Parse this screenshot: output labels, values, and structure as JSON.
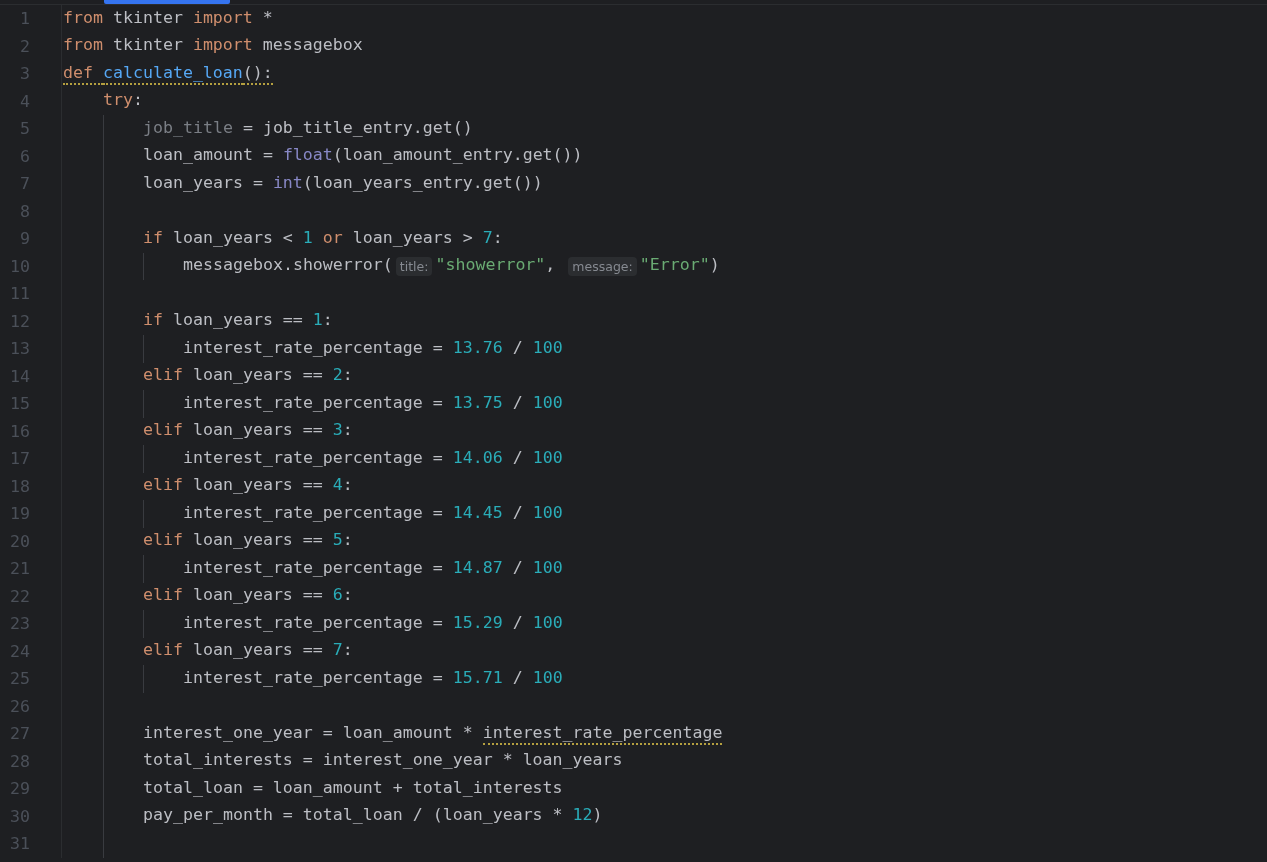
{
  "editor": {
    "lines": [
      {
        "number": "1",
        "tokens": [
          {
            "kind": "keyword",
            "text": "from",
            "warning": false
          },
          {
            "kind": "text",
            "text": " tkinter ",
            "warning": false
          },
          {
            "kind": "keyword",
            "text": "import",
            "warning": false
          },
          {
            "kind": "text",
            "text": " *",
            "warning": false
          }
        ]
      },
      {
        "number": "2",
        "tokens": [
          {
            "kind": "keyword",
            "text": "from",
            "warning": false
          },
          {
            "kind": "text",
            "text": " tkinter ",
            "warning": false
          },
          {
            "kind": "keyword",
            "text": "import",
            "warning": false
          },
          {
            "kind": "text",
            "text": " messagebox",
            "warning": false
          }
        ]
      },
      {
        "number": "3",
        "tokens": [
          {
            "kind": "keyword",
            "text": "def ",
            "warning": true
          },
          {
            "kind": "function",
            "text": "calculate_loan",
            "warning": true
          },
          {
            "kind": "text",
            "text": "():",
            "warning": true
          }
        ],
        "children": [
          {
            "number": "4",
            "tokens": [
              {
                "kind": "keyword",
                "text": "try",
                "warning": false
              },
              {
                "kind": "text",
                "text": ":",
                "warning": false
              }
            ],
            "children": [
              {
                "number": "5",
                "tokens": [
                  {
                    "kind": "unused",
                    "text": "job_title",
                    "warning": false
                  },
                  {
                    "kind": "text",
                    "text": " = job_title_entry.get()",
                    "warning": false
                  }
                ]
              },
              {
                "number": "6",
                "tokens": [
                  {
                    "kind": "text",
                    "text": "loan_amount = ",
                    "warning": false
                  },
                  {
                    "kind": "builtin",
                    "text": "float",
                    "warning": false
                  },
                  {
                    "kind": "text",
                    "text": "(loan_amount_entry.get())",
                    "warning": false
                  }
                ]
              },
              {
                "number": "7",
                "tokens": [
                  {
                    "kind": "text",
                    "text": "loan_years = ",
                    "warning": false
                  },
                  {
                    "kind": "builtin",
                    "text": "int",
                    "warning": false
                  },
                  {
                    "kind": "text",
                    "text": "(loan_years_entry.get())",
                    "warning": false
                  }
                ]
              },
              {
                "number": "8"
              },
              {
                "number": "9",
                "tokens": [
                  {
                    "kind": "keyword",
                    "text": "if",
                    "warning": false
                  },
                  {
                    "kind": "text",
                    "text": " loan_years < ",
                    "warning": false
                  },
                  {
                    "kind": "number",
                    "text": "1",
                    "warning": false
                  },
                  {
                    "kind": "keyword",
                    "text": " or",
                    "warning": false
                  },
                  {
                    "kind": "text",
                    "text": " loan_years > ",
                    "warning": false
                  },
                  {
                    "kind": "number",
                    "text": "7",
                    "warning": false
                  },
                  {
                    "kind": "text",
                    "text": ":",
                    "warning": false
                  }
                ],
                "children": [
                  {
                    "number": "10",
                    "tokens": [
                      {
                        "kind": "text",
                        "text": "messagebox.showerror(",
                        "warning": false
                      },
                      {
                        "kind": "hint",
                        "text": "title:",
                        "warning": false
                      },
                      {
                        "kind": "string",
                        "text": "\"showerror\"",
                        "warning": false
                      },
                      {
                        "kind": "text",
                        "text": ", ",
                        "warning": false
                      },
                      {
                        "kind": "hint",
                        "text": "message:",
                        "warning": false
                      },
                      {
                        "kind": "string",
                        "text": "\"Error\"",
                        "warning": false
                      },
                      {
                        "kind": "text",
                        "text": ")",
                        "warning": false
                      }
                    ]
                  }
                ]
              },
              {
                "number": "11"
              },
              {
                "number": "12",
                "tokens": [
                  {
                    "kind": "keyword",
                    "text": "if",
                    "warning": false
                  },
                  {
                    "kind": "text",
                    "text": " loan_years == ",
                    "warning": false
                  },
                  {
                    "kind": "number",
                    "text": "1",
                    "warning": false
                  },
                  {
                    "kind": "text",
                    "text": ":",
                    "warning": false
                  }
                ],
                "children": [
                  {
                    "number": "13",
                    "tokens": [
                      {
                        "kind": "text",
                        "text": "interest_rate_percentage = ",
                        "warning": false
                      },
                      {
                        "kind": "number",
                        "text": "13.76",
                        "warning": false
                      },
                      {
                        "kind": "text",
                        "text": " / ",
                        "warning": false
                      },
                      {
                        "kind": "number",
                        "text": "100",
                        "warning": false
                      }
                    ]
                  }
                ]
              },
              {
                "number": "14",
                "tokens": [
                  {
                    "kind": "keyword",
                    "text": "elif",
                    "warning": false
                  },
                  {
                    "kind": "text",
                    "text": " loan_years == ",
                    "warning": false
                  },
                  {
                    "kind": "number",
                    "text": "2",
                    "warning": false
                  },
                  {
                    "kind": "text",
                    "text": ":",
                    "warning": false
                  }
                ],
                "children": [
                  {
                    "number": "15",
                    "tokens": [
                      {
                        "kind": "text",
                        "text": "interest_rate_percentage = ",
                        "warning": false
                      },
                      {
                        "kind": "number",
                        "text": "13.75",
                        "warning": false
                      },
                      {
                        "kind": "text",
                        "text": " / ",
                        "warning": false
                      },
                      {
                        "kind": "number",
                        "text": "100",
                        "warning": false
                      }
                    ]
                  }
                ]
              },
              {
                "number": "16",
                "tokens": [
                  {
                    "kind": "keyword",
                    "text": "elif",
                    "warning": false
                  },
                  {
                    "kind": "text",
                    "text": " loan_years == ",
                    "warning": false
                  },
                  {
                    "kind": "number",
                    "text": "3",
                    "warning": false
                  },
                  {
                    "kind": "text",
                    "text": ":",
                    "warning": false
                  }
                ],
                "children": [
                  {
                    "number": "17",
                    "tokens": [
                      {
                        "kind": "text",
                        "text": "interest_rate_percentage = ",
                        "warning": false
                      },
                      {
                        "kind": "number",
                        "text": "14.06",
                        "warning": false
                      },
                      {
                        "kind": "text",
                        "text": " / ",
                        "warning": false
                      },
                      {
                        "kind": "number",
                        "text": "100",
                        "warning": false
                      }
                    ]
                  }
                ]
              },
              {
                "number": "18",
                "tokens": [
                  {
                    "kind": "keyword",
                    "text": "elif",
                    "warning": false
                  },
                  {
                    "kind": "text",
                    "text": " loan_years == ",
                    "warning": false
                  },
                  {
                    "kind": "number",
                    "text": "4",
                    "warning": false
                  },
                  {
                    "kind": "text",
                    "text": ":",
                    "warning": false
                  }
                ],
                "children": [
                  {
                    "number": "19",
                    "tokens": [
                      {
                        "kind": "text",
                        "text": "interest_rate_percentage = ",
                        "warning": false
                      },
                      {
                        "kind": "number",
                        "text": "14.45",
                        "warning": false
                      },
                      {
                        "kind": "text",
                        "text": " / ",
                        "warning": false
                      },
                      {
                        "kind": "number",
                        "text": "100",
                        "warning": false
                      }
                    ]
                  }
                ]
              },
              {
                "number": "20",
                "tokens": [
                  {
                    "kind": "keyword",
                    "text": "elif",
                    "warning": false
                  },
                  {
                    "kind": "text",
                    "text": " loan_years == ",
                    "warning": false
                  },
                  {
                    "kind": "number",
                    "text": "5",
                    "warning": false
                  },
                  {
                    "kind": "text",
                    "text": ":",
                    "warning": false
                  }
                ],
                "children": [
                  {
                    "number": "21",
                    "tokens": [
                      {
                        "kind": "text",
                        "text": "interest_rate_percentage = ",
                        "warning": false
                      },
                      {
                        "kind": "number",
                        "text": "14.87",
                        "warning": false
                      },
                      {
                        "kind": "text",
                        "text": " / ",
                        "warning": false
                      },
                      {
                        "kind": "number",
                        "text": "100",
                        "warning": false
                      }
                    ]
                  }
                ]
              },
              {
                "number": "22",
                "tokens": [
                  {
                    "kind": "keyword",
                    "text": "elif",
                    "warning": false
                  },
                  {
                    "kind": "text",
                    "text": " loan_years == ",
                    "warning": false
                  },
                  {
                    "kind": "number",
                    "text": "6",
                    "warning": false
                  },
                  {
                    "kind": "text",
                    "text": ":",
                    "warning": false
                  }
                ],
                "children": [
                  {
                    "number": "23",
                    "tokens": [
                      {
                        "kind": "text",
                        "text": "interest_rate_percentage = ",
                        "warning": false
                      },
                      {
                        "kind": "number",
                        "text": "15.29",
                        "warning": false
                      },
                      {
                        "kind": "text",
                        "text": " / ",
                        "warning": false
                      },
                      {
                        "kind": "number",
                        "text": "100",
                        "warning": false
                      }
                    ]
                  }
                ]
              },
              {
                "number": "24",
                "tokens": [
                  {
                    "kind": "keyword",
                    "text": "elif",
                    "warning": false
                  },
                  {
                    "kind": "text",
                    "text": " loan_years == ",
                    "warning": false
                  },
                  {
                    "kind": "number",
                    "text": "7",
                    "warning": false
                  },
                  {
                    "kind": "text",
                    "text": ":",
                    "warning": false
                  }
                ],
                "children": [
                  {
                    "number": "25",
                    "tokens": [
                      {
                        "kind": "text",
                        "text": "interest_rate_percentage = ",
                        "warning": false
                      },
                      {
                        "kind": "number",
                        "text": "15.71",
                        "warning": false
                      },
                      {
                        "kind": "text",
                        "text": " / ",
                        "warning": false
                      },
                      {
                        "kind": "number",
                        "text": "100",
                        "warning": false
                      }
                    ]
                  }
                ]
              },
              {
                "number": "26"
              },
              {
                "number": "27",
                "tokens": [
                  {
                    "kind": "text",
                    "text": "interest_one_year = loan_amount * ",
                    "warning": false
                  },
                  {
                    "kind": "text",
                    "text": "interest_rate_percentage",
                    "warning": true
                  }
                ]
              },
              {
                "number": "28",
                "tokens": [
                  {
                    "kind": "text",
                    "text": "total_interests = interest_one_year * loan_years",
                    "warning": false
                  }
                ]
              },
              {
                "number": "29",
                "tokens": [
                  {
                    "kind": "text",
                    "text": "total_loan = loan_amount + total_interests",
                    "warning": false
                  }
                ]
              },
              {
                "number": "30",
                "tokens": [
                  {
                    "kind": "text",
                    "text": "pay_per_month = total_loan / (loan_years * ",
                    "warning": false
                  },
                  {
                    "kind": "number",
                    "text": "12",
                    "warning": false
                  },
                  {
                    "kind": "text",
                    "text": ")",
                    "warning": false
                  }
                ]
              },
              {
                "number": "31"
              }
            ]
          }
        ]
      }
    ]
  }
}
